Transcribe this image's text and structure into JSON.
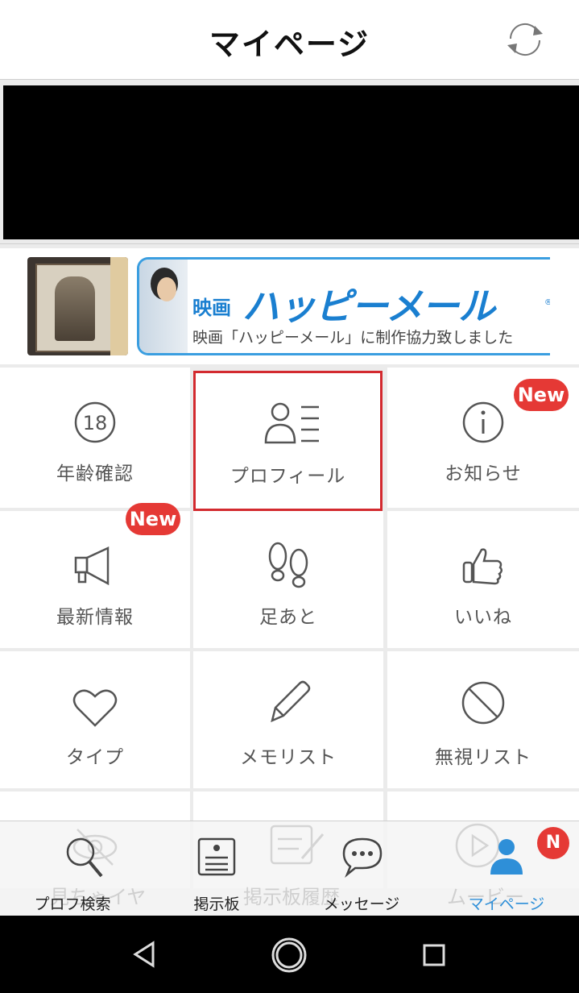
{
  "header": {
    "title": "マイページ",
    "refresh_icon": "refresh-icon"
  },
  "banner": {
    "title_prefix": "映画",
    "title_main": "ハッピーメール",
    "title_reg": "®",
    "subtitle": "映画「ハッピーメール」に制作協力致しました"
  },
  "menu": [
    {
      "label": "年齢確認",
      "icon": "age-18-icon"
    },
    {
      "label": "プロフィール",
      "icon": "profile-list-icon",
      "selected": true
    },
    {
      "label": "お知らせ",
      "icon": "info-icon",
      "badge": "New"
    },
    {
      "label": "最新情報",
      "icon": "megaphone-icon",
      "badge": "New"
    },
    {
      "label": "足あと",
      "icon": "footprints-icon"
    },
    {
      "label": "いいね",
      "icon": "thumbs-up-icon"
    },
    {
      "label": "タイプ",
      "icon": "heart-icon"
    },
    {
      "label": "メモリスト",
      "icon": "pencil-icon"
    },
    {
      "label": "無視リスト",
      "icon": "block-icon"
    }
  ],
  "hidden_row": [
    "見ちゃイヤ",
    "掲示板履歴",
    "ムービー"
  ],
  "tabbar": [
    {
      "label": "プロフ検索",
      "icon": "search-icon"
    },
    {
      "label": "掲示板",
      "icon": "board-icon"
    },
    {
      "label": "メッセージ",
      "icon": "chat-bubble-icon"
    },
    {
      "label": "マイページ",
      "icon": "user-icon",
      "active": true,
      "badge": "N"
    }
  ],
  "colors": {
    "accent": "#2e8fd8",
    "badge": "#e53935",
    "selected_border": "#d32a2f"
  },
  "system_nav": [
    "back-icon",
    "home-icon",
    "recents-icon"
  ]
}
